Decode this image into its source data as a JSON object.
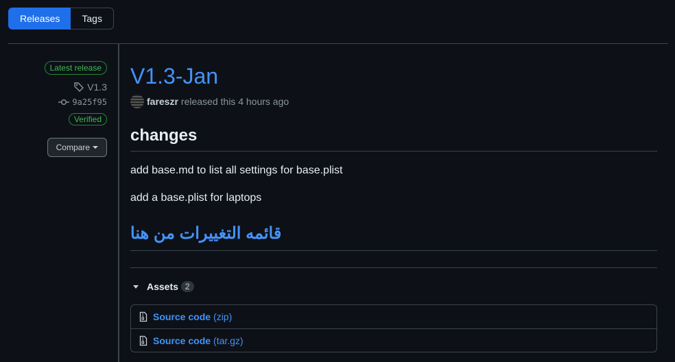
{
  "tabs": {
    "releases": "Releases",
    "tags": "Tags"
  },
  "sidebar": {
    "latest_badge": "Latest release",
    "tag": "V1.3",
    "commit": "9a25f95",
    "verified": "Verified",
    "compare": "Compare"
  },
  "release": {
    "title": "V1.3-Jan",
    "author": "fareszr",
    "released_text": "released this 4 hours ago",
    "heading_changes": "changes",
    "line1": "add base.md to list all settings for base.plist",
    "line2": "add a base.plist for laptops",
    "arabic_link": "قائمه التغييرات من هنا"
  },
  "assets": {
    "label": "Assets",
    "count": "2",
    "items": [
      {
        "name": "Source code",
        "ext": "(zip)"
      },
      {
        "name": "Source code",
        "ext": "(tar.gz)"
      }
    ]
  },
  "colors": {
    "accent": "#4493f8",
    "primary_button": "#1f6feb",
    "verified": "#3fb950",
    "background": "#0d1117"
  }
}
